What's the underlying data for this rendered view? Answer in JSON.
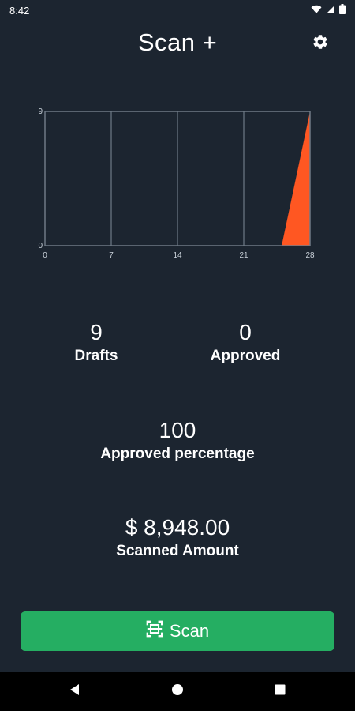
{
  "status_bar": {
    "time": "8:42"
  },
  "header": {
    "title": "Scan +",
    "settings_icon": "gear-icon"
  },
  "chart_data": {
    "type": "area",
    "x": [
      25,
      27,
      28
    ],
    "values": [
      0,
      6,
      9
    ],
    "xticks": [
      "0",
      "7",
      "14",
      "21",
      "28"
    ],
    "yticks": [
      "0",
      "9"
    ],
    "xlim": [
      0,
      28
    ],
    "ylim": [
      0,
      9
    ],
    "grid": "vertical",
    "fill_color": "#ff5722"
  },
  "stats": {
    "drafts": {
      "value": "9",
      "label": "Drafts"
    },
    "approved": {
      "value": "0",
      "label": "Approved"
    },
    "approved_percentage": {
      "value": "100",
      "label": "Approved percentage"
    },
    "scanned_amount": {
      "value": "$ 8,948.00",
      "label": "Scanned Amount"
    }
  },
  "scan_button": {
    "label": "Scan",
    "icon": "document-scan-icon",
    "color": "#25ae62"
  },
  "colors": {
    "background": "#1c2530",
    "accent": "#ff5722"
  }
}
